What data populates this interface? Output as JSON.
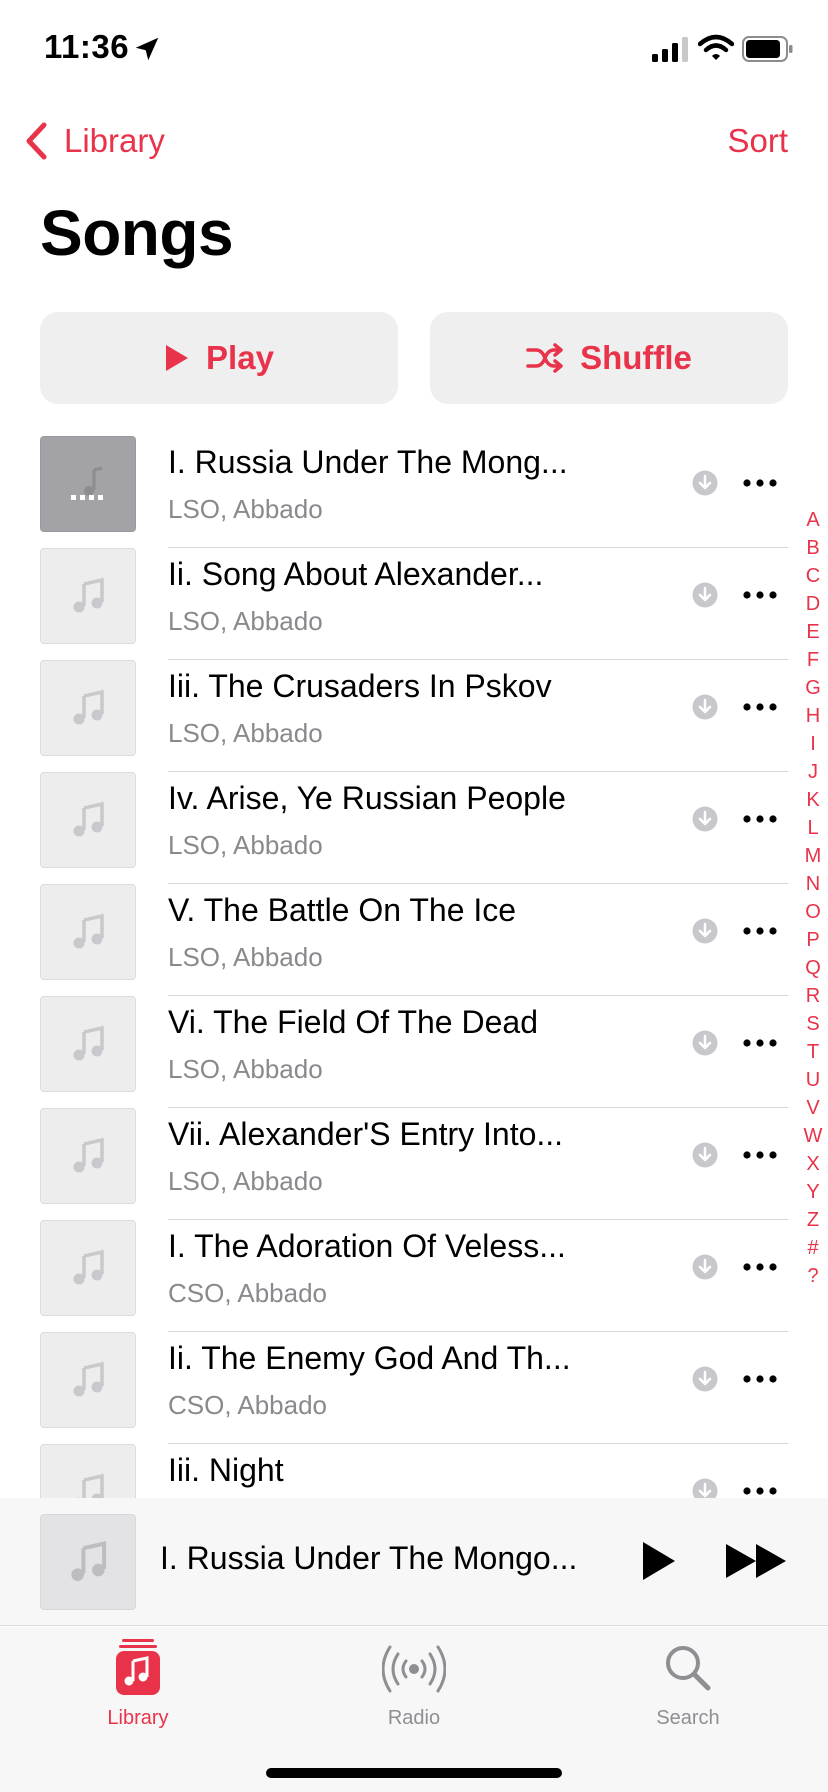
{
  "status_bar": {
    "time": "11:36"
  },
  "nav": {
    "back_label": "Library",
    "sort_label": "Sort"
  },
  "page_title": "Songs",
  "actions": {
    "play_label": "Play",
    "shuffle_label": "Shuffle"
  },
  "songs": [
    {
      "title": "I. Russia Under The Mong...",
      "artist": "LSO, Abbado"
    },
    {
      "title": "Ii. Song About Alexander...",
      "artist": "LSO, Abbado"
    },
    {
      "title": "Iii. The Crusaders In Pskov",
      "artist": "LSO, Abbado"
    },
    {
      "title": "Iv. Arise, Ye Russian People",
      "artist": "LSO, Abbado"
    },
    {
      "title": "V. The Battle On The Ice",
      "artist": "LSO, Abbado"
    },
    {
      "title": "Vi. The Field Of The Dead",
      "artist": "LSO, Abbado"
    },
    {
      "title": "Vii. Alexander'S Entry Into...",
      "artist": "LSO, Abbado"
    },
    {
      "title": "I. The Adoration Of Veless...",
      "artist": "CSO, Abbado"
    },
    {
      "title": "Ii. The Enemy God And Th...",
      "artist": "CSO, Abbado"
    },
    {
      "title": "Iii. Night",
      "artist": ""
    }
  ],
  "alphabet_index": [
    "A",
    "B",
    "C",
    "D",
    "E",
    "F",
    "G",
    "H",
    "I",
    "J",
    "K",
    "L",
    "M",
    "N",
    "O",
    "P",
    "Q",
    "R",
    "S",
    "T",
    "U",
    "V",
    "W",
    "X",
    "Y",
    "Z",
    "#",
    "?"
  ],
  "mini_player": {
    "title": "I. Russia Under The Mongo..."
  },
  "tab_bar": {
    "library_label": "Library",
    "radio_label": "Radio",
    "search_label": "Search"
  },
  "colors": {
    "accent": "#e8334a",
    "secondary_text": "#8a8a8e"
  }
}
